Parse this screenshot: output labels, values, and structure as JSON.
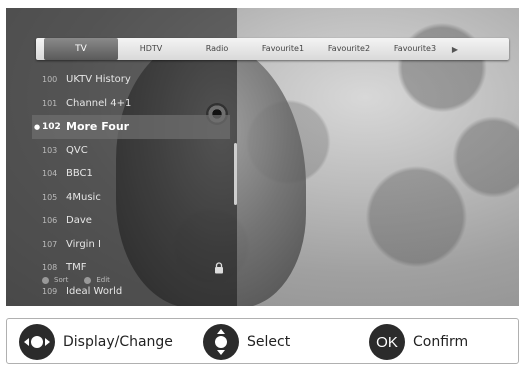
{
  "tabs": [
    "TV",
    "HDTV",
    "Radio",
    "Favourite1",
    "Favourite2",
    "Favourite3"
  ],
  "tab_more_icon": "arrow-right-icon",
  "channels": [
    {
      "number": "100",
      "name": "UKTV History",
      "selected": false,
      "locked": false
    },
    {
      "number": "101",
      "name": "Channel 4+1",
      "selected": false,
      "locked": false
    },
    {
      "number": "102",
      "name": "More Four",
      "selected": true,
      "locked": false
    },
    {
      "number": "103",
      "name": "QVC",
      "selected": false,
      "locked": false
    },
    {
      "number": "104",
      "name": "BBC1",
      "selected": false,
      "locked": false
    },
    {
      "number": "105",
      "name": "4Music",
      "selected": false,
      "locked": false
    },
    {
      "number": "106",
      "name": "Dave",
      "selected": false,
      "locked": false
    },
    {
      "number": "107",
      "name": "Virgin I",
      "selected": false,
      "locked": false
    },
    {
      "number": "108",
      "name": "TMF",
      "selected": false,
      "locked": true
    },
    {
      "number": "109",
      "name": "Ideal World",
      "selected": false,
      "locked": false
    }
  ],
  "screen_hints": [
    "Sort",
    "Edit"
  ],
  "legend": {
    "display_change": "Display/Change",
    "select": "Select",
    "ok": "OK",
    "confirm": "Confirm"
  }
}
